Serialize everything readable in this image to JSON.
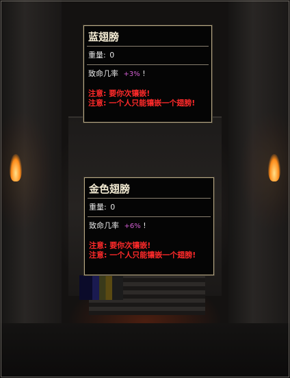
{
  "items": [
    {
      "title": "蓝翅膀",
      "weight_label": "重量:",
      "weight_value": "0",
      "crit_label": "致命几率",
      "crit_value": "+3%",
      "crit_suffix": "!",
      "notes": [
        "注意: 要你次镶嵌!",
        "注意: 一个人只能镶嵌一个翅膀!"
      ]
    },
    {
      "title": "金色翅膀",
      "weight_label": "重量:",
      "weight_value": "0",
      "crit_label": "致命几率",
      "crit_value": "+6%",
      "crit_suffix": "!",
      "notes": [
        "注意: 要你次镶嵌!",
        "注意: 一个人只能镶嵌一个翅膀!"
      ]
    }
  ],
  "colors": {
    "title": "#f2ead2",
    "text": "#e8e8e8",
    "stat_value": "#d25fd2",
    "warning": "#ff2a2a",
    "border": "#b9aa86"
  }
}
